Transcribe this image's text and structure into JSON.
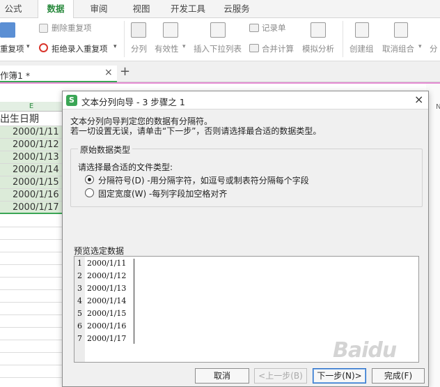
{
  "tabs": [
    "公式",
    "数据",
    "审阅",
    "视图",
    "开发工具",
    "云服务"
  ],
  "active_tab": "数据",
  "ribbon": {
    "remove_duplicates": "删除重复项",
    "duplicates_dropdown": "重复项",
    "reject_duplicates": "拒绝录入重复项",
    "split": "分列",
    "validity": "有效性",
    "insert_dropdown": "插入下拉列表",
    "record_form": "记录单",
    "consolidate": "合并计算",
    "what_if": "模拟分析",
    "create_group": "创建组",
    "ungroup": "取消组合",
    "subtotal_partial": "分"
  },
  "workbook": {
    "tab_label": "作簿1 *",
    "close": "×",
    "add": "+"
  },
  "sheet": {
    "column_letter": "E",
    "header": "出生日期",
    "cells": [
      "2000/1/11",
      "2000/1/12",
      "2000/1/13",
      "2000/1/14",
      "2000/1/15",
      "2000/1/16",
      "2000/1/17"
    ],
    "right_partial": "N"
  },
  "dialog": {
    "logo": "S",
    "title": "文本分列向导 - 3 步骤之 1",
    "close": "×",
    "intro_line1": "文本分列向导判定您的数据有分隔符。",
    "intro_line2": "若一切设置无误，请单击“下一步”，否则请选择最合适的数据类型。",
    "group_title": "原始数据类型",
    "prompt": "请选择最合适的文件类型:",
    "options": [
      {
        "label": "分隔符号(D)  -用分隔字符，如逗号或制表符分隔每个字段",
        "selected": true
      },
      {
        "label": "固定宽度(W)  -每列字段加空格对齐",
        "selected": false
      }
    ],
    "preview_title": "预览选定数据",
    "preview_rows": [
      {
        "n": "1",
        "v": "2000/1/11"
      },
      {
        "n": "2",
        "v": "2000/1/12"
      },
      {
        "n": "3",
        "v": "2000/1/13"
      },
      {
        "n": "4",
        "v": "2000/1/14"
      },
      {
        "n": "5",
        "v": "2000/1/15"
      },
      {
        "n": "6",
        "v": "2000/1/16"
      },
      {
        "n": "7",
        "v": "2000/1/17"
      }
    ],
    "buttons": {
      "cancel": "取消",
      "back": "<上一步(B)",
      "next": "下一步(N)>",
      "finish": "完成(F)"
    }
  },
  "watermark": "Baidu"
}
